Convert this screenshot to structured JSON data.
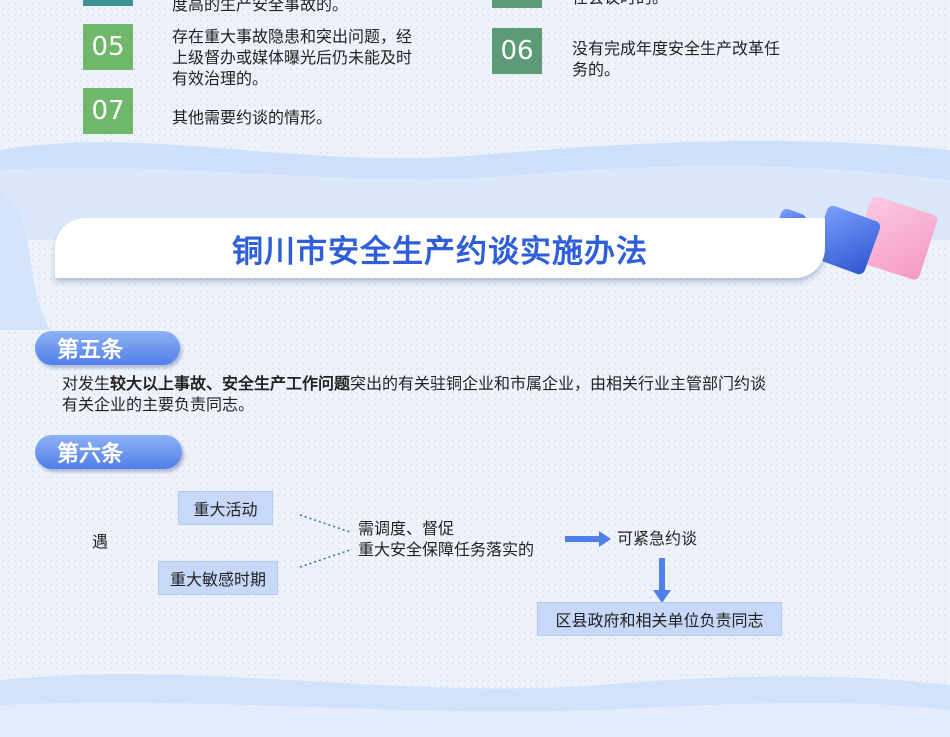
{
  "top_items": {
    "item_prev_text": "度高的生产安全事故的。",
    "item_prev_right_text": "任会议时的。",
    "item_05": {
      "num": "05",
      "text_l1": "存在重大事故隐患和突出问题，经",
      "text_l2": "上级督办或媒体曝光后仍未能及时",
      "text_l3": "有效治理的。"
    },
    "item_06": {
      "num": "06",
      "text_l1": "没有完成年度安全生产改革任",
      "text_l2": "务的。"
    },
    "item_07": {
      "num": "07",
      "text": "其他需要约谈的情形。"
    }
  },
  "banner": {
    "title": "铜川市安全生产约谈实施办法"
  },
  "article5": {
    "label": "第五条",
    "line1_pre": "对发生",
    "line1_bold": "较大以上事故、安全生产工作问题",
    "line1_post": "突出的有关驻铜企业和市属企业，由相关行业主管部门约谈",
    "line2": "有关企业的主要负责同志。"
  },
  "article6": {
    "label": "第六条",
    "encounter": "遇",
    "box_major_event": "重大活动",
    "box_sensitive_period": "重大敏感时期",
    "mid_l1": "需调度、督促",
    "mid_l2": "重大安全保障任务落实的",
    "urgent": "可紧急约谈",
    "final_box": "区县政府和相关单位负责同志"
  },
  "colors": {
    "title_blue": "#2f5fd8",
    "number_green": "#6fb86a",
    "number_dark_green": "#5d9a76",
    "arrow_blue": "#4f7fe8",
    "box_blue": "#c7d8f8"
  }
}
